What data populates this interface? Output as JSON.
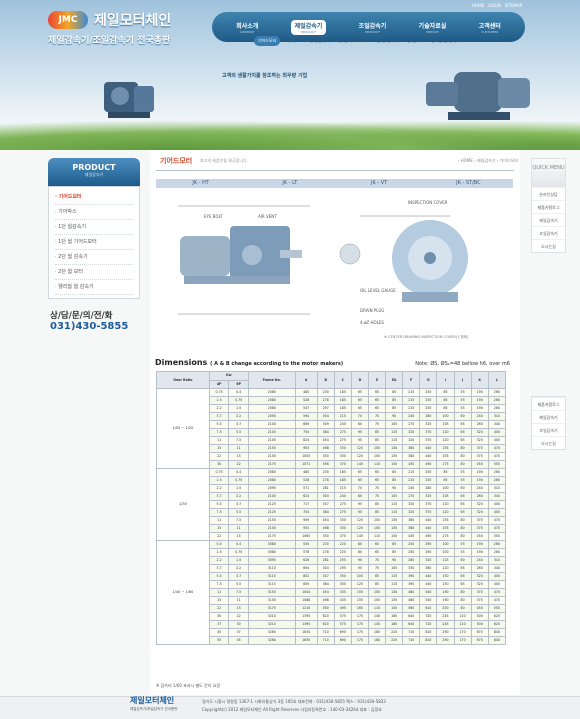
{
  "brand": {
    "logo_mark": "JMC",
    "name": "제일모터체인",
    "tagline": "제일감속기/조일감속기 전국총판"
  },
  "util_links": [
    "HOME",
    "LOGIN",
    "SITEMAP"
  ],
  "nav": [
    {
      "ko": "회사소개",
      "en": "COMPANY"
    },
    {
      "ko": "제일감속기",
      "en": "PRODUCT"
    },
    {
      "ko": "조일감속기",
      "en": "PRODUCT"
    },
    {
      "ko": "기술자료실",
      "en": "SERVICE"
    },
    {
      "ko": "고객센터",
      "en": "CUSTOMER"
    }
  ],
  "subnav": [
    "기어드모터",
    "기어박스",
    "1단 웜감속기",
    "1단 웜 기어드모터",
    "2단 웜 감속기",
    "2단 웜 모터",
    "웰리웜 웜 감속기"
  ],
  "slogan": "고객의 생활가치를 창조하는 최우량 기업",
  "sidebar": {
    "title": "PRODUCT",
    "subtitle": "제일감속기",
    "items": [
      "· 기어드모터",
      "· 기어박스",
      "· 1단 웜감속기",
      "· 1단 웜 기어드모터",
      "· 2단 웜 감속기",
      "· 2단 웜 모터",
      "· 웰리웜 웜 감속기"
    ],
    "contact_label": "상/담/문/의/전/화",
    "contact_phone": "031)430-5855"
  },
  "page": {
    "title": "기어드모터",
    "desc": "최고의 제품만을 제공합니다.",
    "breadcrumb": "› HOME  ›  제일감속기  ›  기어드모터"
  },
  "models": [
    "JK - HT",
    "JK - LT",
    "JK - VT",
    "JK - ST/BC"
  ],
  "drawing": {
    "inspection": "INSPECTION COVER",
    "oil_level": "OIL LEVEL GAUGE",
    "drain": "DRAIN PLUG",
    "holes": "4-øZ HOLES",
    "air_vent": "AIR VENT",
    "eye_bolt": "EYE BOLT",
    "note": "※ CENTER DRAWING INSPECTION COVER(1 형태)"
  },
  "dimensions": {
    "title": "Dimensions",
    "subtitle": "( A & B change according to the motor makers)",
    "note": "Note: ØS, ØS₁=48 bellow h6, over m6"
  },
  "table": {
    "headers": [
      "Gear Ratio",
      "Kw",
      "Frame No.",
      "A",
      "B",
      "C",
      "D",
      "E",
      "EA",
      "F",
      "G",
      "I",
      "J",
      "K",
      "L"
    ],
    "kw_sub": [
      "4P",
      "6P"
    ],
    "groups": [
      {
        "ratio": "1/05 ~ 1/20",
        "rows": [
          [
            "0.75",
            "0.4",
            "2080",
            "480",
            "230",
            "185",
            "65",
            "65",
            "85",
            "215",
            "255",
            "85",
            "55",
            "190",
            "260"
          ],
          [
            "1.5",
            "0.75",
            "2080",
            "528",
            "278",
            "185",
            "65",
            "65",
            "85",
            "215",
            "255",
            "85",
            "55",
            "190",
            "260"
          ],
          [
            "2.2",
            "1.5",
            "2080",
            "547",
            "297",
            "185",
            "65",
            "65",
            "85",
            "215",
            "255",
            "85",
            "55",
            "190",
            "260"
          ],
          [
            "3.7",
            "2.2",
            "2090",
            "594",
            "304",
            "215",
            "70",
            "70",
            "90",
            "240",
            "280",
            "100",
            "60",
            "240",
            "310"
          ],
          [
            "5.5",
            "3.7",
            "2100",
            "669",
            "349",
            "240",
            "80",
            "75",
            "105",
            "275",
            "325",
            "105",
            "65",
            "260",
            "340"
          ],
          [
            "7.5",
            "5.5",
            "2105",
            "754",
            "384",
            "275",
            "95",
            "85",
            "115",
            "320",
            "370",
            "120",
            "65",
            "320",
            "400"
          ],
          [
            "11",
            "7.5",
            "2105",
            "824",
            "454",
            "275",
            "95",
            "85",
            "115",
            "320",
            "370",
            "120",
            "65",
            "320",
            "400"
          ],
          [
            "15",
            "11",
            "2150",
            "953",
            "498",
            "330",
            "125",
            "100",
            "130",
            "380",
            "440",
            "155",
            "80",
            "370",
            "470"
          ],
          [
            "22",
            "15",
            "2150",
            "1005",
            "550",
            "330",
            "125",
            "100",
            "130",
            "380",
            "440",
            "155",
            "80",
            "370",
            "470"
          ],
          [
            "30",
            "22",
            "2175",
            "1071",
            "556",
            "370",
            "145",
            "110",
            "150",
            "430",
            "490",
            "175",
            "80",
            "450",
            "550"
          ]
        ]
      },
      {
        "ratio": "1/30",
        "rows": [
          [
            "0.75",
            "0.4",
            "2080",
            "480",
            "230",
            "185",
            "65",
            "65",
            "85",
            "215",
            "255",
            "85",
            "55",
            "190",
            "260"
          ],
          [
            "1.5",
            "0.75",
            "2080",
            "528",
            "278",
            "185",
            "65",
            "65",
            "85",
            "215",
            "255",
            "85",
            "55",
            "190",
            "260"
          ],
          [
            "2.2",
            "1.5",
            "2095",
            "571",
            "281",
            "215",
            "70",
            "70",
            "90",
            "240",
            "280",
            "100",
            "60",
            "240",
            "310"
          ],
          [
            "3.7",
            "2.2",
            "2100",
            "624",
            "304",
            "240",
            "80",
            "75",
            "105",
            "275",
            "325",
            "105",
            "65",
            "260",
            "340"
          ],
          [
            "5.5",
            "3.7",
            "2125",
            "717",
            "347",
            "275",
            "95",
            "85",
            "115",
            "320",
            "370",
            "120",
            "65",
            "320",
            "400"
          ],
          [
            "7.5",
            "5.5",
            "2125",
            "754",
            "384",
            "275",
            "95",
            "85",
            "115",
            "320",
            "370",
            "120",
            "65",
            "320",
            "400"
          ],
          [
            "11",
            "7.5",
            "2150",
            "909",
            "454",
            "330",
            "125",
            "100",
            "130",
            "380",
            "440",
            "155",
            "80",
            "370",
            "470"
          ],
          [
            "15",
            "11",
            "2150",
            "953",
            "498",
            "330",
            "125",
            "100",
            "130",
            "380",
            "440",
            "155",
            "80",
            "370",
            "470"
          ],
          [
            "22",
            "15",
            "2175",
            "1065",
            "550",
            "370",
            "145",
            "110",
            "150",
            "430",
            "490",
            "175",
            "80",
            "450",
            "550"
          ]
        ]
      },
      {
        "ratio": "1/40 ~ 1/60",
        "rows": [
          [
            "0.5",
            "0.4",
            "3080",
            "530",
            "230",
            "220",
            "80",
            "60",
            "85",
            "250",
            "290",
            "100",
            "55",
            "190",
            "260"
          ],
          [
            "1.5",
            "0.75",
            "3080",
            "578",
            "278",
            "220",
            "80",
            "65",
            "85",
            "250",
            "290",
            "100",
            "55",
            "190",
            "260"
          ],
          [
            "2.2",
            "1.5",
            "3095",
            "626",
            "281",
            "255",
            "90",
            "70",
            "90",
            "285",
            "320",
            "115",
            "60",
            "240",
            "310"
          ],
          [
            "3.7",
            "2.2",
            "3110",
            "694",
            "304",
            "295",
            "95",
            "75",
            "105",
            "330",
            "380",
            "120",
            "65",
            "260",
            "340"
          ],
          [
            "5.5",
            "3.7",
            "3115",
            "802",
            "347",
            "350",
            "105",
            "85",
            "115",
            "390",
            "440",
            "150",
            "65",
            "320",
            "400"
          ],
          [
            "7.5",
            "5.5",
            "3115",
            "859",
            "384",
            "350",
            "125",
            "85",
            "115",
            "390",
            "440",
            "150",
            "65",
            "320",
            "400"
          ],
          [
            "11",
            "7.5",
            "3150",
            "1044",
            "454",
            "435",
            "155",
            "100",
            "130",
            "480",
            "540",
            "190",
            "80",
            "370",
            "470"
          ],
          [
            "15",
            "11",
            "3150",
            "1088",
            "498",
            "435",
            "155",
            "100",
            "130",
            "480",
            "540",
            "190",
            "80",
            "370",
            "470"
          ],
          [
            "22",
            "15",
            "3175",
            "1210",
            "550",
            "495",
            "165",
            "110",
            "150",
            "560",
            "610",
            "200",
            "80",
            "450",
            "550"
          ],
          [
            "30",
            "22",
            "3210",
            "1395",
            "620",
            "575",
            "170",
            "140",
            "180",
            "640",
            "720",
            "245",
            "120",
            "500",
            "620"
          ],
          [
            "37",
            "30",
            "3210",
            "1395",
            "620",
            "575",
            "170",
            "140",
            "180",
            "640",
            "720",
            "245",
            "120",
            "500",
            "620"
          ],
          [
            "45",
            "37",
            "3260",
            "1630",
            "710",
            "690",
            "170",
            "180",
            "220",
            "710",
            "810",
            "290",
            "170",
            "670",
            "840"
          ],
          [
            "55",
            "45",
            "3260",
            "1630",
            "710",
            "690",
            "170",
            "180",
            "220",
            "710",
            "810",
            "290",
            "170",
            "670",
            "840"
          ]
        ]
      }
    ]
  },
  "footnote": "※ 감속비 1/60 초과시 별도 문의 요망",
  "quick": {
    "title": "QUICK MENU",
    "items": [
      "온라인상담",
      "제품카탈로그",
      "제일감속기",
      "조일감속기",
      "오시는길"
    ],
    "items2": [
      "제품카탈로그",
      "제일감속기",
      "조일감속기",
      "오시는길"
    ]
  },
  "footer": {
    "logo": "제일모터체인",
    "logo_sub": "제일감속기/조일감속기 전국총판",
    "line1": "경기도 시흥시 정왕동 1367-1 시화유통상가 3동 105호    대표전화 : 031)430-5855    팩스 : 031)430-5833",
    "line2": "Copyright(c) 2012  제일모터체인  All Right Reserves     사업자등록번호 : 140-03-34264   대표 : 김정호"
  },
  "colors": {
    "nav": "#1f5a85",
    "accent": "#d8462b",
    "phone": "#1d5c9a"
  }
}
